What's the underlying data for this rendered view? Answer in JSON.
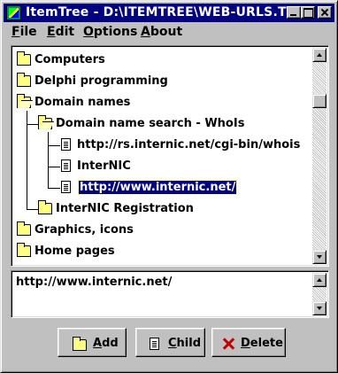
{
  "window": {
    "title": "ItemTree - D:\\ITEMTREE\\WEB-URLS.TRE"
  },
  "menu": [
    {
      "label": "File"
    },
    {
      "label": "Edit"
    },
    {
      "label": "Options"
    },
    {
      "label": "About"
    }
  ],
  "tree": {
    "nodes": [
      {
        "label": "Computers",
        "icon": "folder-closed-icon"
      },
      {
        "label": "Delphi programming",
        "icon": "folder-closed-icon"
      },
      {
        "label": "Domain names",
        "icon": "folder-open-icon"
      },
      {
        "label": "Domain name search - WhoIs",
        "icon": "folder-open-icon"
      },
      {
        "label": "http://rs.internic.net/cgi-bin/whois",
        "icon": "document-icon"
      },
      {
        "label": "InterNIC",
        "icon": "document-icon"
      },
      {
        "label": "http://www.internic.net/",
        "icon": "document-icon",
        "selected": true
      },
      {
        "label": "InterNIC Registration",
        "icon": "folder-closed-icon"
      },
      {
        "label": "Graphics, icons",
        "icon": "folder-closed-icon"
      },
      {
        "label": "Home pages",
        "icon": "folder-closed-icon"
      }
    ]
  },
  "memo": {
    "text": "http://www.internic.net/"
  },
  "buttons": {
    "add": "Add",
    "child": "Child",
    "delete": "Delete"
  },
  "colors": {
    "titlebar": "#000080",
    "face": "#c0c0c0",
    "selection": "#000080",
    "folder": "#ffff80",
    "delete_icon": "#c00000"
  }
}
